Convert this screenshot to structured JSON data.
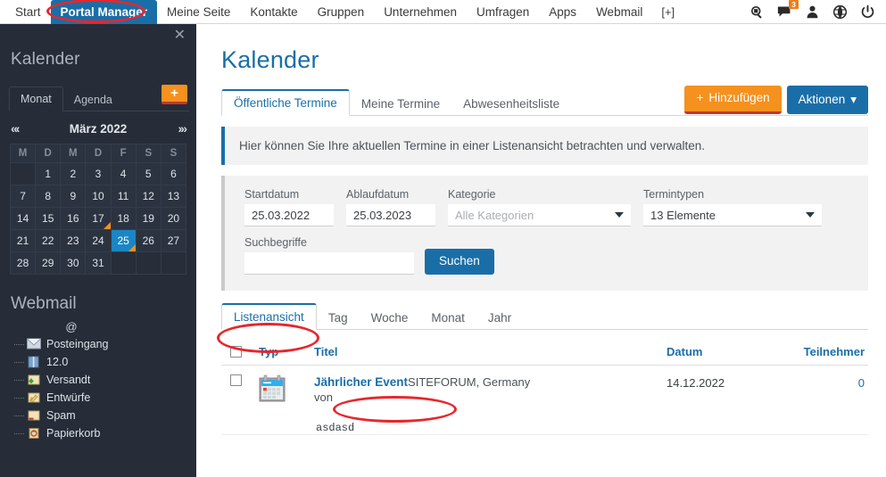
{
  "topnav": {
    "items": [
      {
        "label": "Start",
        "active": false
      },
      {
        "label": "Portal Manager",
        "active": true
      },
      {
        "label": "Meine Seite",
        "active": false
      },
      {
        "label": "Kontakte",
        "active": false
      },
      {
        "label": "Gruppen",
        "active": false
      },
      {
        "label": "Unternehmen",
        "active": false
      },
      {
        "label": "Umfragen",
        "active": false
      },
      {
        "label": "Apps",
        "active": false
      },
      {
        "label": "Webmail",
        "active": false
      }
    ],
    "more_label": "[+]",
    "icons": [
      {
        "name": "search-icon"
      },
      {
        "name": "chat-icon",
        "badge": "3"
      },
      {
        "name": "user-icon"
      },
      {
        "name": "globe-icon"
      },
      {
        "name": "power-icon"
      }
    ]
  },
  "sidebar": {
    "close_label": "✕",
    "calendar_title": "Kalender",
    "tabs": [
      {
        "label": "Monat",
        "active": true
      },
      {
        "label": "Agenda",
        "active": false
      }
    ],
    "add_label": "+",
    "prev_label": "«‹",
    "next_label": "›»",
    "month_label": "März 2022",
    "weekday_headers": [
      "M",
      "D",
      "M",
      "D",
      "F",
      "S",
      "S"
    ],
    "weeks": [
      [
        {
          "d": ""
        },
        {
          "d": "1"
        },
        {
          "d": "2"
        },
        {
          "d": "3"
        },
        {
          "d": "4"
        },
        {
          "d": "5"
        },
        {
          "d": "6"
        }
      ],
      [
        {
          "d": "7"
        },
        {
          "d": "8"
        },
        {
          "d": "9"
        },
        {
          "d": "10"
        },
        {
          "d": "11"
        },
        {
          "d": "12"
        },
        {
          "d": "13"
        }
      ],
      [
        {
          "d": "14"
        },
        {
          "d": "15"
        },
        {
          "d": "16"
        },
        {
          "d": "17",
          "mark": true
        },
        {
          "d": "18"
        },
        {
          "d": "19"
        },
        {
          "d": "20"
        }
      ],
      [
        {
          "d": "21"
        },
        {
          "d": "22"
        },
        {
          "d": "23"
        },
        {
          "d": "24"
        },
        {
          "d": "25",
          "mark": true,
          "selected": true
        },
        {
          "d": "26"
        },
        {
          "d": "27"
        }
      ],
      [
        {
          "d": "28"
        },
        {
          "d": "29"
        },
        {
          "d": "30"
        },
        {
          "d": "31"
        },
        {
          "d": ""
        },
        {
          "d": ""
        },
        {
          "d": ""
        }
      ]
    ],
    "webmail_title": "Webmail",
    "webmail_root": "@",
    "webmail_items": [
      {
        "label": "Posteingang",
        "icon": "inbox-icon"
      },
      {
        "label": "12.0",
        "icon": "folder-blue-icon"
      },
      {
        "label": "Versandt",
        "icon": "sent-icon"
      },
      {
        "label": "Entwürfe",
        "icon": "drafts-icon"
      },
      {
        "label": "Spam",
        "icon": "spam-icon"
      },
      {
        "label": "Papierkorb",
        "icon": "trash-icon"
      }
    ]
  },
  "main": {
    "page_title": "Kalender",
    "tabs": [
      {
        "label": "Öffentliche Termine",
        "active": true
      },
      {
        "label": "Meine Termine",
        "active": false
      },
      {
        "label": "Abwesenheitsliste",
        "active": false
      }
    ],
    "add_button": "Hinzufügen",
    "actions_button": "Aktionen",
    "banner_text": "Hier können Sie Ihre aktuellen Termine in einer Listenansicht betrachten und verwalten.",
    "filter": {
      "start_label": "Startdatum",
      "start_value": "25.03.2022",
      "end_label": "Ablaufdatum",
      "end_value": "25.03.2023",
      "category_label": "Kategorie",
      "category_placeholder": "Alle Kategorien",
      "types_label": "Termintypen",
      "types_value": "13 Elemente",
      "search_label": "Suchbegriffe",
      "search_value": "",
      "search_button": "Suchen"
    },
    "view_tabs": [
      {
        "label": "Listenansicht",
        "active": true
      },
      {
        "label": "Tag",
        "active": false
      },
      {
        "label": "Woche",
        "active": false
      },
      {
        "label": "Monat",
        "active": false
      },
      {
        "label": "Jahr",
        "active": false
      }
    ],
    "table": {
      "headers": {
        "typ": "Typ",
        "titel": "Titel",
        "datum": "Datum",
        "teilnehmer": "Teilnehmer"
      },
      "rows": [
        {
          "type_icon": "calendar-icon",
          "title": "Jährlicher Event",
          "subtitle": "SITEFORUM, Germany",
          "subtitle2": "von",
          "description": "asdasd",
          "date": "14.12.2022",
          "participants": "0"
        }
      ]
    }
  },
  "colors": {
    "accent_blue": "#1a6ea8",
    "accent_orange": "#f5911e",
    "sidebar_bg": "#262d38",
    "annotation_red": "#e8262b",
    "selected_day": "#1a86c4"
  }
}
